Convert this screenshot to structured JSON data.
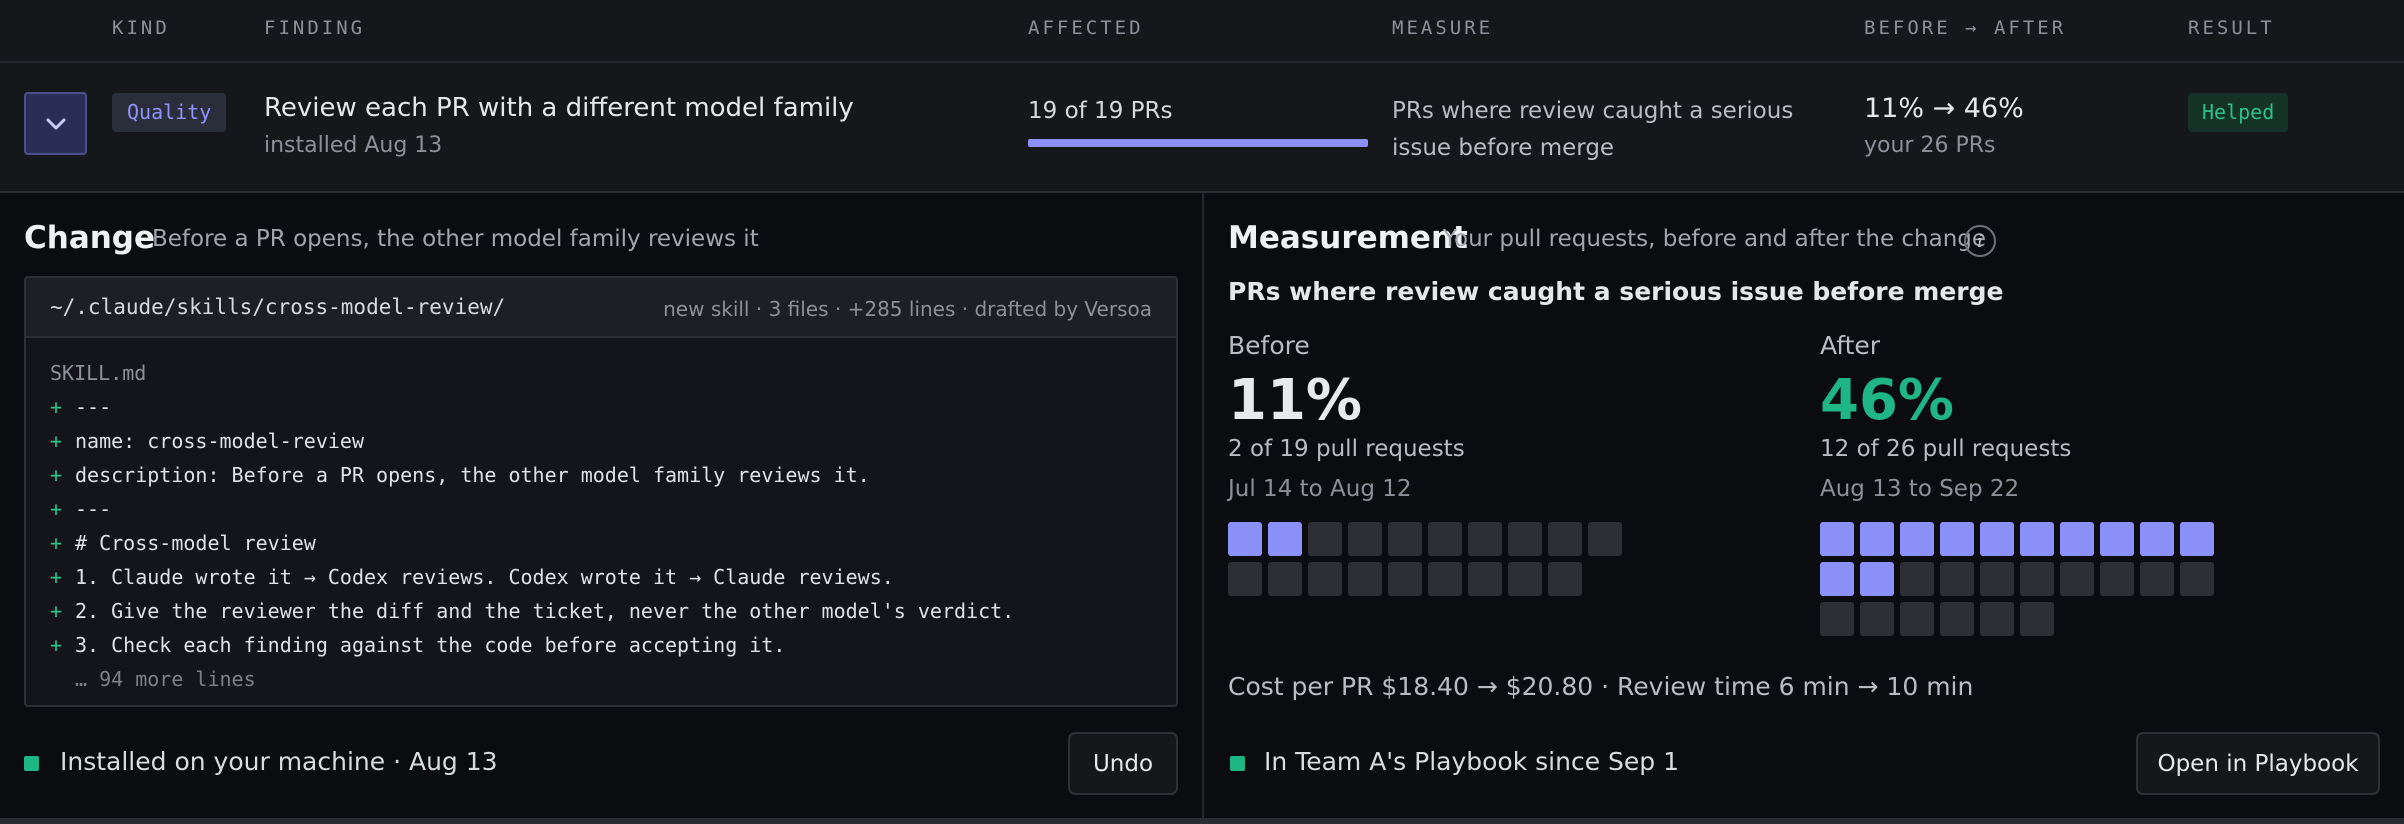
{
  "header": {
    "kind": "KIND",
    "finding": "FINDING",
    "affected": "AFFECTED",
    "measure": "MEASURE",
    "before_after": "BEFORE → AFTER",
    "result": "RESULT"
  },
  "row": {
    "kind_badge": "Quality",
    "finding_title": "Review each PR with a different model family",
    "finding_sub": "installed Aug 13",
    "affected_text": "19 of 19 PRs",
    "affected_fraction": 1.0,
    "measure_text": "PRs where review caught a serious issue before merge",
    "before_after": "11% → 46%",
    "before_after_sub": "your 26 PRs",
    "result_badge": "Helped",
    "expand_icon": "chevron-down-icon"
  },
  "change": {
    "title": "Change",
    "subtitle": "Before a PR opens, the other model family reviews it",
    "code_path": "~/.claude/skills/cross-model-review/",
    "code_meta": "new skill · 3 files · +285 lines · drafted by Versoa",
    "file_name": "SKILL.md",
    "lines": [
      "---",
      "name: cross-model-review",
      "description: Before a PR opens, the other model family reviews it.",
      "---",
      "# Cross-model review",
      "1. Claude wrote it → Codex reviews. Codex wrote it → Claude reviews.",
      "2. Give the reviewer the diff and the ticket, never the other model's verdict.",
      "3. Check each finding against the code before accepting it."
    ],
    "more_lines": "… 94 more lines",
    "status_text": "Installed on your machine · Aug 13",
    "undo_label": "Undo"
  },
  "measurement": {
    "title": "Measurement",
    "subtitle": "Your pull requests, before and after the change",
    "info_icon": "i",
    "metric_title": "PRs where review caught a serious issue before merge",
    "before": {
      "label": "Before",
      "value": "11%",
      "count": "2 of 19 pull requests",
      "range": "Jul 14 to Aug 12",
      "total": 19,
      "hits": 2
    },
    "after": {
      "label": "After",
      "value": "46%",
      "count": "12 of 26 pull requests",
      "range": "Aug 13 to Sep 22",
      "total": 26,
      "hits": 12
    },
    "cost_line": "Cost per PR $18.40 → $20.80 · Review time 6 min → 10 min",
    "playbook_text": "In Team A's Playbook since Sep 1",
    "open_label": "Open in Playbook"
  },
  "colors": {
    "accent": "#8b8ff8",
    "success": "#1eb783",
    "after_value": "#1fb585"
  }
}
